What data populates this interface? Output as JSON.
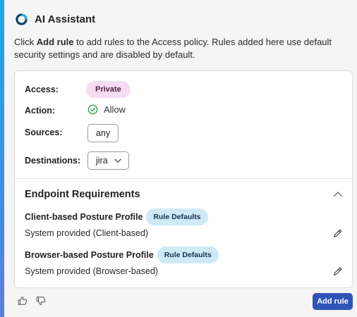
{
  "header": {
    "title": "AI Assistant",
    "logo_icon": "assistant-logo-icon"
  },
  "intro": {
    "prefix": "Click ",
    "emphasis": "Add rule",
    "suffix": " to add rules to the Access policy. Rules added here use default security settings and are disabled by default."
  },
  "rule": {
    "access_label": "Access:",
    "access_value": "Private",
    "action_label": "Action:",
    "action_value": "Allow",
    "sources_label": "Sources:",
    "sources_value": "any",
    "destinations_label": "Destinations:",
    "destinations_value": "jira"
  },
  "endpoint": {
    "title": "Endpoint Requirements",
    "profiles": [
      {
        "name": "Client-based Posture Profile",
        "badge": "Rule Defaults",
        "value": "System provided (Client-based)"
      },
      {
        "name": "Browser-based Posture Profile",
        "badge": "Rule Defaults",
        "value": "System provided (Browser-based)"
      }
    ]
  },
  "footer": {
    "add_rule_label": "Add rule"
  },
  "colors": {
    "accent": "#2f55b8",
    "private_chip": "#f6dcf2",
    "defaults_badge": "#cfe9f6",
    "allow_green": "#2e9e4a"
  }
}
